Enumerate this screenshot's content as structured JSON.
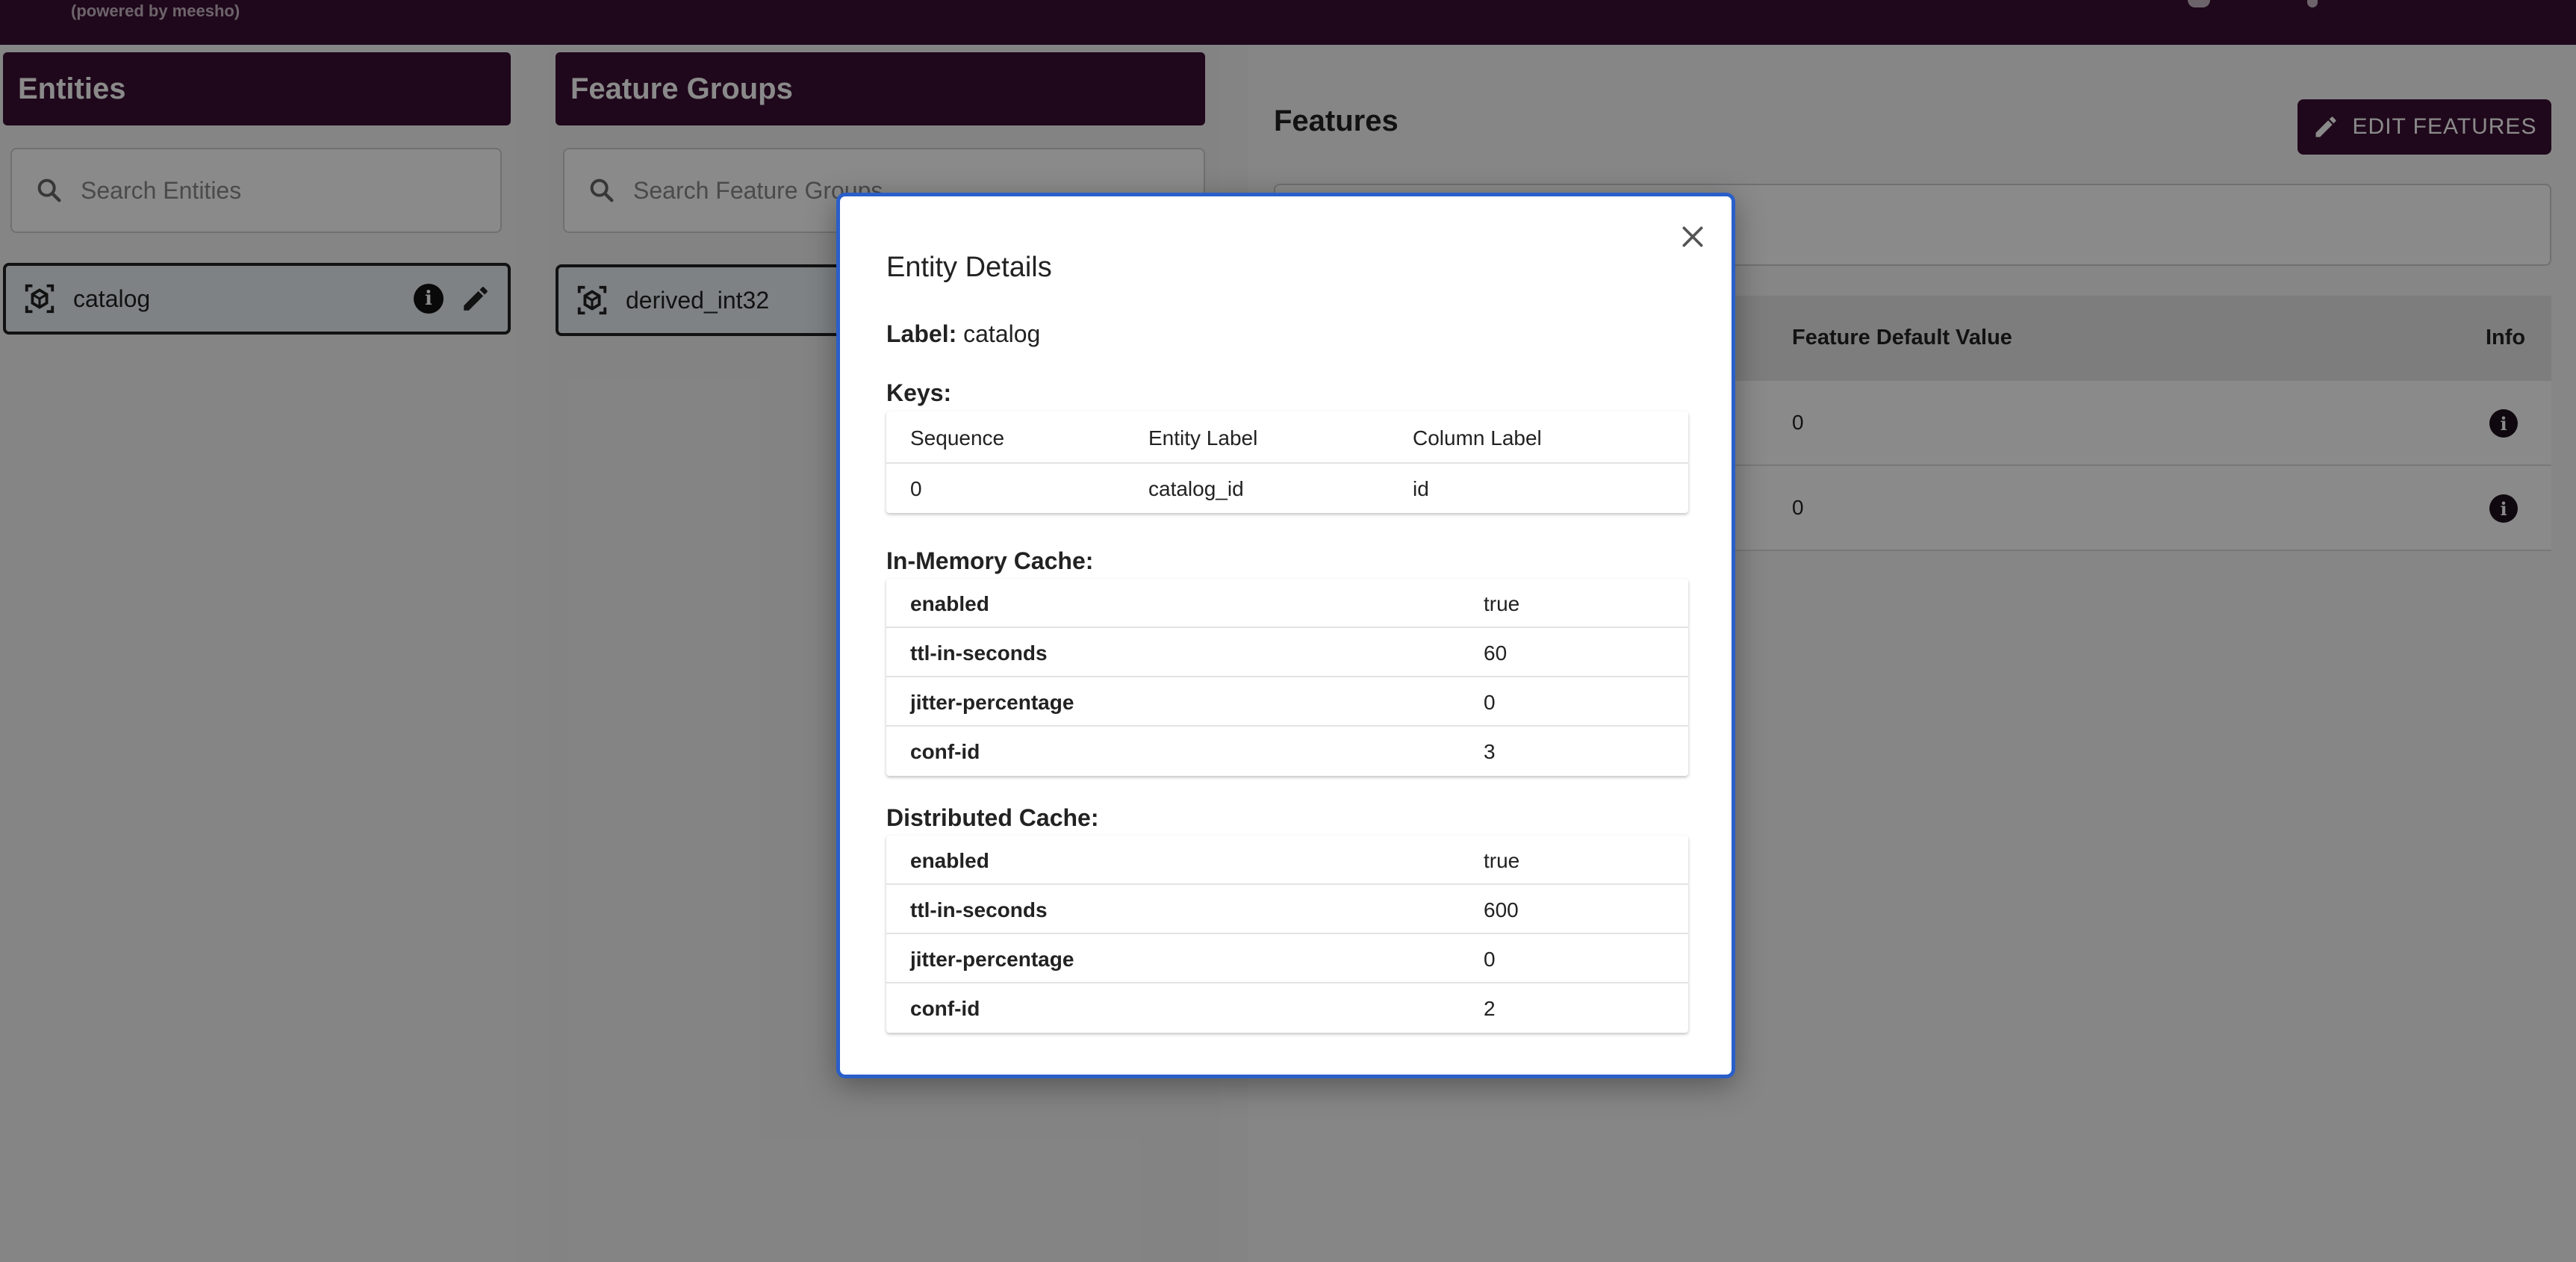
{
  "topbar": {
    "powered": "(powered by meesho)"
  },
  "entities": {
    "title": "Entities",
    "search_placeholder": "Search Entities",
    "items": [
      {
        "label": "catalog"
      }
    ]
  },
  "feature_groups": {
    "title": "Feature Groups",
    "search_placeholder": "Search Feature Groups",
    "items": [
      {
        "label": "derived_int32"
      }
    ]
  },
  "features": {
    "title": "Features",
    "edit_button": "EDIT FEATURES",
    "columns": [
      "Feature Default Value",
      "Info"
    ],
    "rows": [
      {
        "default_value": "0"
      },
      {
        "default_value": "0"
      }
    ]
  },
  "modal": {
    "title": "Entity Details",
    "label_key": "Label:",
    "label_value": "catalog",
    "keys_title": "Keys:",
    "keys_columns": [
      "Sequence",
      "Entity Label",
      "Column Label"
    ],
    "keys_rows": [
      {
        "sequence": "0",
        "entity_label": "catalog_id",
        "column_label": "id"
      }
    ],
    "in_memory_title": "In-Memory Cache:",
    "in_memory": [
      {
        "key": "enabled",
        "value": "true"
      },
      {
        "key": "ttl-in-seconds",
        "value": "60"
      },
      {
        "key": "jitter-percentage",
        "value": "0"
      },
      {
        "key": "conf-id",
        "value": "3"
      }
    ],
    "distributed_title": "Distributed Cache:",
    "distributed": [
      {
        "key": "enabled",
        "value": "true"
      },
      {
        "key": "ttl-in-seconds",
        "value": "600"
      },
      {
        "key": "jitter-percentage",
        "value": "0"
      },
      {
        "key": "conf-id",
        "value": "2"
      }
    ]
  }
}
